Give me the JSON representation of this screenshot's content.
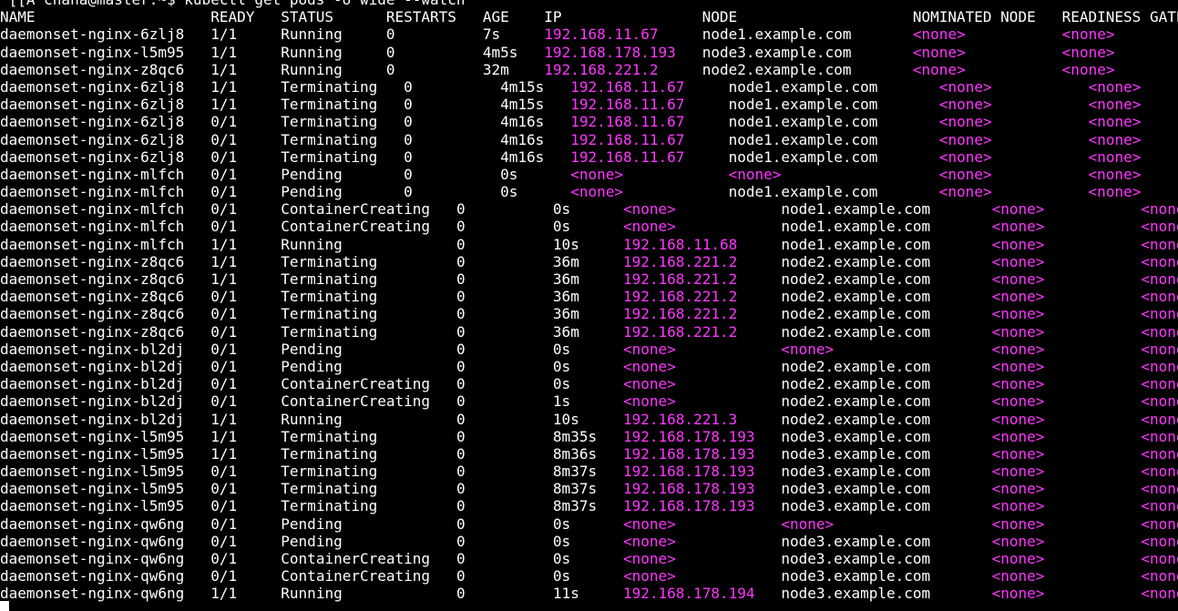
{
  "terminal": {
    "command_line": "^[[A chana@master:~$ kubectl get pods -o wide --watch",
    "colors": {
      "background": "#000000",
      "text": "#ffffff",
      "highlight": "#ff36ff"
    },
    "header": [
      "NAME",
      "READY",
      "STATUS",
      "RESTARTS",
      "AGE",
      "IP",
      "NODE",
      "NOMINATED NODE",
      "READINESS GATES"
    ],
    "rows": [
      [
        "daemonset-nginx-6zlj8",
        "1/1",
        "Running",
        "0",
        "7s",
        "192.168.11.67",
        "node1.example.com",
        "<none>",
        "<none>"
      ],
      [
        "daemonset-nginx-l5m95",
        "1/1",
        "Running",
        "0",
        "4m5s",
        "192.168.178.193",
        "node3.example.com",
        "<none>",
        "<none>"
      ],
      [
        "daemonset-nginx-z8qc6",
        "1/1",
        "Running",
        "0",
        "32m",
        "192.168.221.2",
        "node2.example.com",
        "<none>",
        "<none>"
      ],
      [
        "daemonset-nginx-6zlj8",
        "1/1",
        "Terminating",
        "0",
        "4m15s",
        "192.168.11.67",
        "node1.example.com",
        "<none>",
        "<none>"
      ],
      [
        "daemonset-nginx-6zlj8",
        "1/1",
        "Terminating",
        "0",
        "4m15s",
        "192.168.11.67",
        "node1.example.com",
        "<none>",
        "<none>"
      ],
      [
        "daemonset-nginx-6zlj8",
        "0/1",
        "Terminating",
        "0",
        "4m16s",
        "192.168.11.67",
        "node1.example.com",
        "<none>",
        "<none>"
      ],
      [
        "daemonset-nginx-6zlj8",
        "0/1",
        "Terminating",
        "0",
        "4m16s",
        "192.168.11.67",
        "node1.example.com",
        "<none>",
        "<none>"
      ],
      [
        "daemonset-nginx-6zlj8",
        "0/1",
        "Terminating",
        "0",
        "4m16s",
        "192.168.11.67",
        "node1.example.com",
        "<none>",
        "<none>"
      ],
      [
        "daemonset-nginx-mlfch",
        "0/1",
        "Pending",
        "0",
        "0s",
        "<none>",
        "<none>",
        "<none>",
        "<none>"
      ],
      [
        "daemonset-nginx-mlfch",
        "0/1",
        "Pending",
        "0",
        "0s",
        "<none>",
        "node1.example.com",
        "<none>",
        "<none>"
      ],
      [
        "daemonset-nginx-mlfch",
        "0/1",
        "ContainerCreating",
        "0",
        "0s",
        "<none>",
        "node1.example.com",
        "<none>",
        "<none>"
      ],
      [
        "daemonset-nginx-mlfch",
        "0/1",
        "ContainerCreating",
        "0",
        "0s",
        "<none>",
        "node1.example.com",
        "<none>",
        "<none>"
      ],
      [
        "daemonset-nginx-mlfch",
        "1/1",
        "Running",
        "0",
        "10s",
        "192.168.11.68",
        "node1.example.com",
        "<none>",
        "<none>"
      ],
      [
        "daemonset-nginx-z8qc6",
        "1/1",
        "Terminating",
        "0",
        "36m",
        "192.168.221.2",
        "node2.example.com",
        "<none>",
        "<none>"
      ],
      [
        "daemonset-nginx-z8qc6",
        "1/1",
        "Terminating",
        "0",
        "36m",
        "192.168.221.2",
        "node2.example.com",
        "<none>",
        "<none>"
      ],
      [
        "daemonset-nginx-z8qc6",
        "0/1",
        "Terminating",
        "0",
        "36m",
        "192.168.221.2",
        "node2.example.com",
        "<none>",
        "<none>"
      ],
      [
        "daemonset-nginx-z8qc6",
        "0/1",
        "Terminating",
        "0",
        "36m",
        "192.168.221.2",
        "node2.example.com",
        "<none>",
        "<none>"
      ],
      [
        "daemonset-nginx-z8qc6",
        "0/1",
        "Terminating",
        "0",
        "36m",
        "192.168.221.2",
        "node2.example.com",
        "<none>",
        "<none>"
      ],
      [
        "daemonset-nginx-bl2dj",
        "0/1",
        "Pending",
        "0",
        "0s",
        "<none>",
        "<none>",
        "<none>",
        "<none>"
      ],
      [
        "daemonset-nginx-bl2dj",
        "0/1",
        "Pending",
        "0",
        "0s",
        "<none>",
        "node2.example.com",
        "<none>",
        "<none>"
      ],
      [
        "daemonset-nginx-bl2dj",
        "0/1",
        "ContainerCreating",
        "0",
        "0s",
        "<none>",
        "node2.example.com",
        "<none>",
        "<none>"
      ],
      [
        "daemonset-nginx-bl2dj",
        "0/1",
        "ContainerCreating",
        "0",
        "1s",
        "<none>",
        "node2.example.com",
        "<none>",
        "<none>"
      ],
      [
        "daemonset-nginx-bl2dj",
        "1/1",
        "Running",
        "0",
        "10s",
        "192.168.221.3",
        "node2.example.com",
        "<none>",
        "<none>"
      ],
      [
        "daemonset-nginx-l5m95",
        "1/1",
        "Terminating",
        "0",
        "8m35s",
        "192.168.178.193",
        "node3.example.com",
        "<none>",
        "<none>"
      ],
      [
        "daemonset-nginx-l5m95",
        "1/1",
        "Terminating",
        "0",
        "8m36s",
        "192.168.178.193",
        "node3.example.com",
        "<none>",
        "<none>"
      ],
      [
        "daemonset-nginx-l5m95",
        "0/1",
        "Terminating",
        "0",
        "8m37s",
        "192.168.178.193",
        "node3.example.com",
        "<none>",
        "<none>"
      ],
      [
        "daemonset-nginx-l5m95",
        "0/1",
        "Terminating",
        "0",
        "8m37s",
        "192.168.178.193",
        "node3.example.com",
        "<none>",
        "<none>"
      ],
      [
        "daemonset-nginx-l5m95",
        "0/1",
        "Terminating",
        "0",
        "8m37s",
        "192.168.178.193",
        "node3.example.com",
        "<none>",
        "<none>"
      ],
      [
        "daemonset-nginx-qw6ng",
        "0/1",
        "Pending",
        "0",
        "0s",
        "<none>",
        "<none>",
        "<none>",
        "<none>"
      ],
      [
        "daemonset-nginx-qw6ng",
        "0/1",
        "Pending",
        "0",
        "0s",
        "<none>",
        "node3.example.com",
        "<none>",
        "<none>"
      ],
      [
        "daemonset-nginx-qw6ng",
        "0/1",
        "ContainerCreating",
        "0",
        "0s",
        "<none>",
        "node3.example.com",
        "<none>",
        "<none>"
      ],
      [
        "daemonset-nginx-qw6ng",
        "0/1",
        "ContainerCreating",
        "0",
        "0s",
        "<none>",
        "node3.example.com",
        "<none>",
        "<none>"
      ],
      [
        "daemonset-nginx-qw6ng",
        "1/1",
        "Running",
        "0",
        "11s",
        "192.168.178.194",
        "node3.example.com",
        "<none>",
        "<none>"
      ]
    ]
  }
}
